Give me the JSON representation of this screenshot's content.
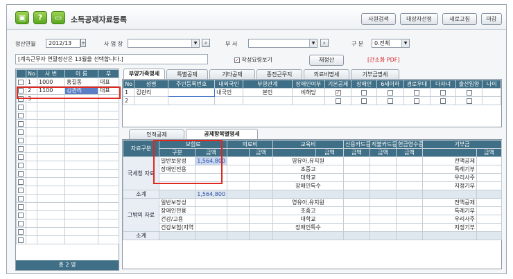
{
  "window": {
    "title": "소득공제자료등록",
    "icons": [
      "monitor-icon",
      "help-icon",
      "screen-icon"
    ],
    "buttons": [
      "사원검색",
      "대상자선정",
      "새로고침",
      "마감"
    ]
  },
  "filters": {
    "period_label": "정산연월",
    "period_value": "2012/13",
    "site_label": "사 업 장",
    "site_value": "",
    "dept_label": "부   서",
    "dept_value": "",
    "div_label": "구   분",
    "div_value": "0.전체"
  },
  "notice": "[계속근무자 연말정산은 13월을 선택합니다.]",
  "guide_checkbox": {
    "label": "작성요령보기",
    "checked": true
  },
  "recalc_button": "재정산",
  "pdf_link": "[간소화 PDF]",
  "employee_list": {
    "headers": [
      "No",
      "사   번",
      "이   름",
      "부"
    ],
    "rows": [
      {
        "no": "1",
        "id": "1000",
        "name": "홍길동",
        "dept": "대표"
      },
      {
        "no": "2",
        "id": "1100",
        "name": "김관리",
        "dept": "대표"
      },
      {
        "no": "3",
        "id": "",
        "name": "",
        "dept": ""
      }
    ],
    "footer": "총 2 명"
  },
  "top_tabs": [
    "부양가족명세",
    "특별공제",
    "기타공제",
    "종전근무지",
    "의료비명세",
    "기부금명세"
  ],
  "family_table": {
    "headers": [
      "No",
      "성명",
      "주민등록번호",
      "내외국인",
      "부양관계",
      "장애인여부",
      "기본공제",
      "장애인",
      "6세이하",
      "경로우대",
      "다자녀",
      "출산입양",
      "나이"
    ],
    "rows": [
      {
        "no": "1",
        "name": "김관리",
        "rrn": "",
        "nat": "내국인",
        "rel": "본인",
        "disabled": "비해당",
        "basic": true
      },
      {
        "no": "2",
        "name": "",
        "rrn": "",
        "nat": "",
        "rel": "",
        "disabled": "",
        "basic": false
      }
    ]
  },
  "bottom_tabs": [
    "인적공제",
    "공제항목별명세"
  ],
  "deduction": {
    "col_groups": [
      "자료구분",
      "보험료",
      "의료비",
      "교육비",
      "신용카드등",
      "직불카드등",
      "현금영수증",
      "기부금"
    ],
    "sub_gubun": "구분",
    "sub_amount": "금액",
    "nts_label": "국세청 자료",
    "other_label": "그밖의 자료",
    "subtotal_label": "소계",
    "insurance_rows": [
      "일반보장성",
      "장애인전용",
      "",
      ""
    ],
    "other_insurance_rows": [
      "일반보장성",
      "장애인전용",
      "건강/고용",
      "건강보험(지역"
    ],
    "insurance_amount": "1,564,800",
    "subtotal_amount": "1,564,800",
    "edu_rows": [
      "영유아,유치원",
      "초중고",
      "대학교",
      "장애인특수"
    ],
    "donation_rows": [
      "전액공제",
      "특례기부",
      "우리사주",
      "지정기부"
    ]
  }
}
